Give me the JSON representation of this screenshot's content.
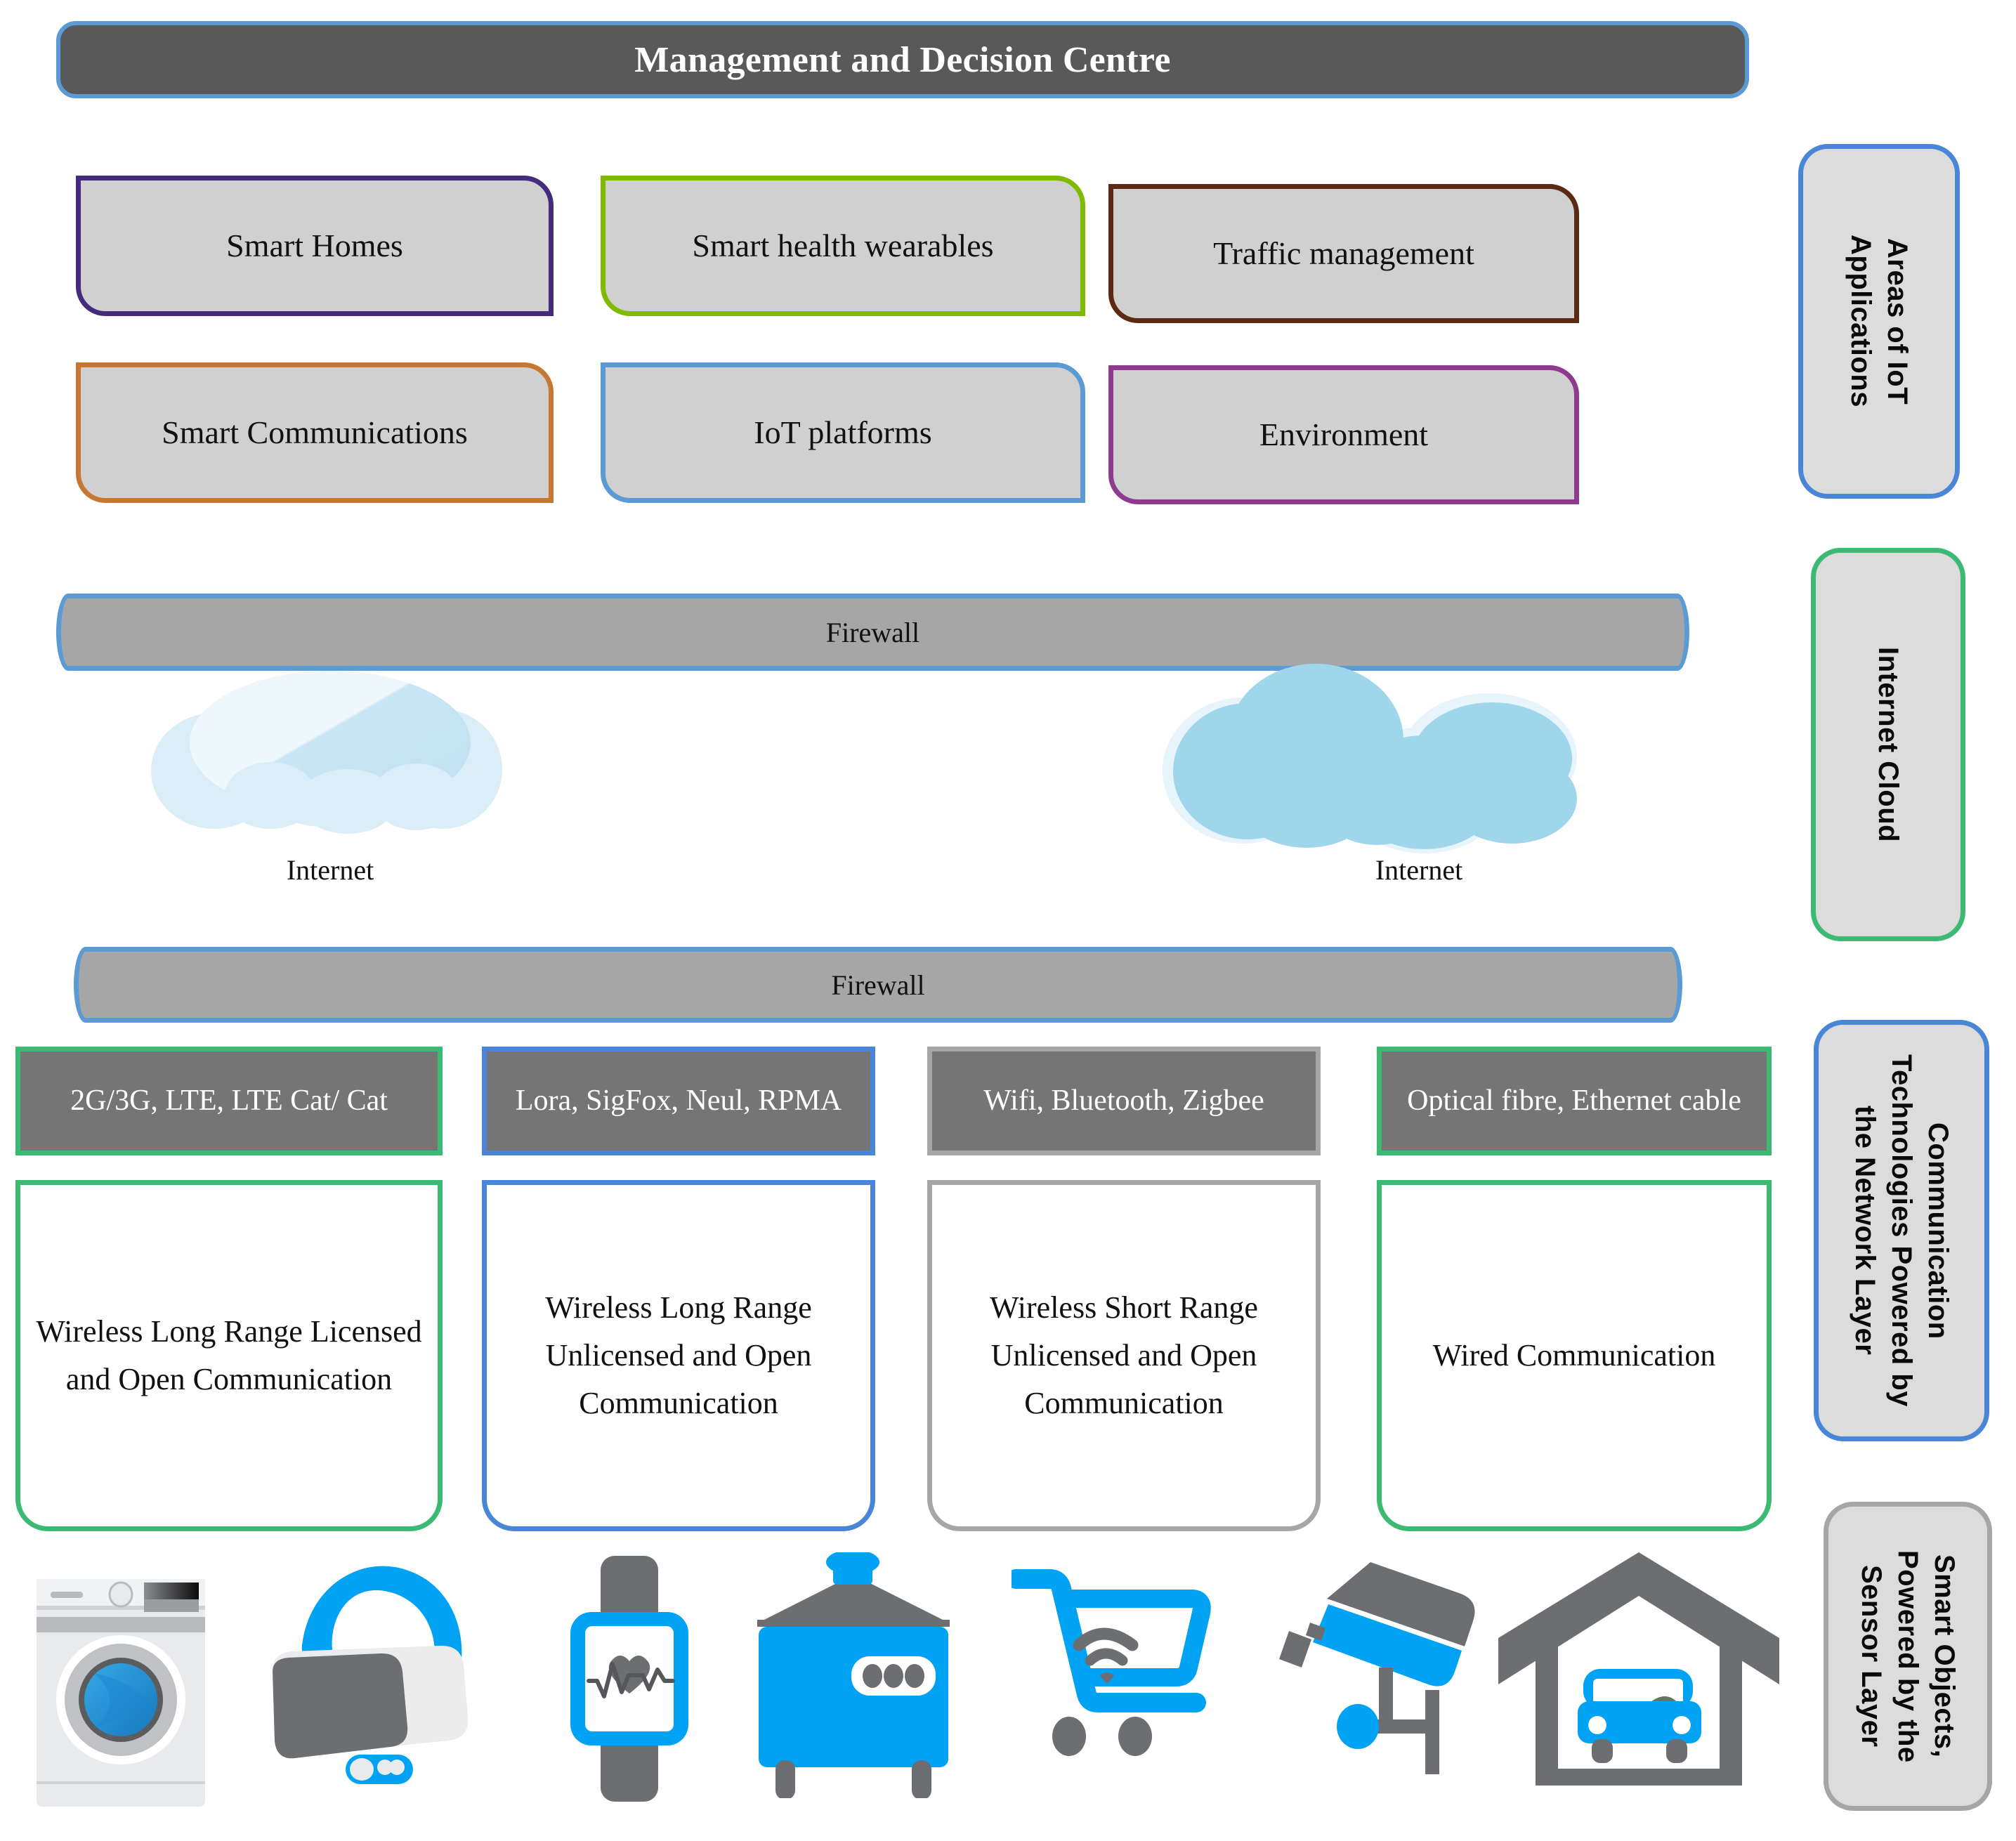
{
  "title": {
    "text": "Management and Decision Centre"
  },
  "applications": [
    {
      "label": "Smart Homes",
      "border": "#452b7d"
    },
    {
      "label": "Smart health wearables",
      "border": "#7fba00"
    },
    {
      "label": "Traffic management",
      "border": "#5c2a12"
    },
    {
      "label": "Smart Communications",
      "border": "#c87733"
    },
    {
      "label": "IoT platforms",
      "border": "#5b9bd5"
    },
    {
      "label": "Environment",
      "border": "#8e3a8e"
    }
  ],
  "firewalls": [
    {
      "label": "Firewall"
    },
    {
      "label": "Firewall"
    }
  ],
  "clouds": [
    {
      "label": "Internet"
    },
    {
      "label": "Internet"
    }
  ],
  "technologies": [
    {
      "header": "2G/3G, LTE, LTE Cat/ Cat",
      "body": "Wireless Long Range Licensed and Open Communication",
      "color": "#3cba73"
    },
    {
      "header": "Lora, SigFox, Neul, RPMA",
      "body": "Wireless Long Range Unlicensed and Open Communication",
      "color": "#4a86d8"
    },
    {
      "header": "Wifi, Bluetooth, Zigbee",
      "body": "Wireless Short Range Unlicensed and Open Communication",
      "color": "#a6a6a6"
    },
    {
      "header": "Optical fibre, Ethernet cable",
      "body": "Wired Communication",
      "color": "#3cba73"
    }
  ],
  "layer_tags": [
    {
      "label": "Areas of IoT\nApplications",
      "border": "#4a86d8"
    },
    {
      "label": "Internet Cloud",
      "border": "#3cba73"
    },
    {
      "label": "Communication\nTechnologies Powered by\nthe Network Layer",
      "border": "#4a86d8"
    },
    {
      "label": "Smart Objects,\nPowered by the\nSensor Layer",
      "border": "#a6a6a6"
    }
  ],
  "smart_objects": [
    {
      "name": "washing-machine-icon"
    },
    {
      "name": "vr-headset-icon"
    },
    {
      "name": "smartwatch-heartrate-icon"
    },
    {
      "name": "pressure-cooker-icon"
    },
    {
      "name": "smart-shopping-cart-icon"
    },
    {
      "name": "cctv-camera-icon"
    },
    {
      "name": "garage-with-car-icon"
    }
  ],
  "colors": {
    "accent_blue": "#5b9bd5",
    "dark_bar": "#595959",
    "firewall_gray": "#a6a6a6",
    "box_gray": "#d0d0d0",
    "tech_head_gray": "#757575",
    "icon_blue": "#00a2f3",
    "icon_gray": "#6d6e71"
  }
}
